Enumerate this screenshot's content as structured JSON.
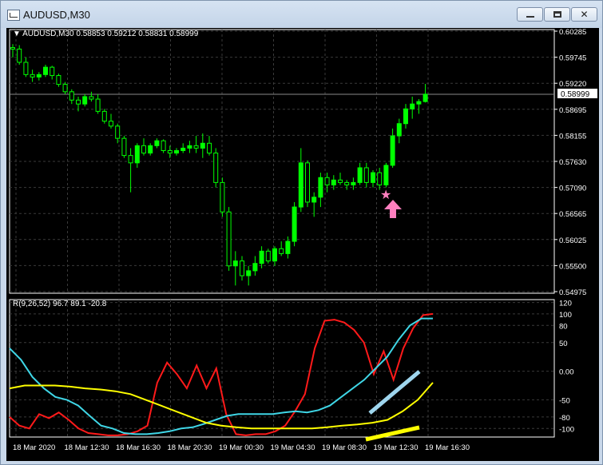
{
  "window": {
    "title": "AUDUSD,M30",
    "controls": {
      "minimize_icon": "minimize-icon",
      "maximize_icon": "maximize-icon",
      "close_label": "✕"
    }
  },
  "colors": {
    "background": "#000000",
    "grid": "#3a3a3a",
    "bull_candle": "#00ff00",
    "bear_candle": "#000000",
    "indicator_red": "#ff1a1a",
    "indicator_cyan": "#3fd6e6",
    "indicator_yellow": "#ffff00",
    "marker_pink": "#ff7fbf",
    "trend_line_lightblue": "#9fd6ee"
  },
  "main_panel": {
    "symbol_label": "AUDUSD,M30",
    "ohlc_text": "0.58853 0.59212 0.58831 0.58999",
    "current_price": "0.58999",
    "price_ticks": [
      "0.60285",
      "0.59745",
      "0.59220",
      "0.58695",
      "0.58155",
      "0.57630",
      "0.57090",
      "0.56565",
      "0.56025",
      "0.55500",
      "0.54975"
    ]
  },
  "indicator_panel": {
    "label": "R(9,26,52) 96.7 89.1 -20.8",
    "ticks": [
      "120",
      "100",
      "80",
      "50",
      "0.00",
      "-50",
      "-80",
      "-100"
    ]
  },
  "time_axis": {
    "labels": [
      "18 Mar 2020",
      "18 Mar 12:30",
      "18 Mar 16:30",
      "18 Mar 20:30",
      "19 Mar 00:30",
      "19 Mar 04:30",
      "19 Mar 08:30",
      "19 Mar 12:30",
      "19 Mar 16:30"
    ]
  },
  "chart_data": {
    "type": "candlestick",
    "price_range": [
      0.54975,
      0.60285
    ],
    "candles": [
      [
        0.5995,
        0.6002,
        0.5975,
        0.5992
      ],
      [
        0.5992,
        0.6,
        0.596,
        0.5965
      ],
      [
        0.5965,
        0.5975,
        0.5935,
        0.594
      ],
      [
        0.594,
        0.595,
        0.5925,
        0.5935
      ],
      [
        0.5935,
        0.5945,
        0.5928,
        0.594
      ],
      [
        0.594,
        0.596,
        0.5935,
        0.5955
      ],
      [
        0.5955,
        0.5958,
        0.593,
        0.5938
      ],
      [
        0.5938,
        0.5942,
        0.5915,
        0.592
      ],
      [
        0.592,
        0.5925,
        0.59,
        0.5905
      ],
      [
        0.5905,
        0.591,
        0.588,
        0.5888
      ],
      [
        0.5888,
        0.5895,
        0.5865,
        0.588
      ],
      [
        0.588,
        0.59,
        0.5875,
        0.5895
      ],
      [
        0.5895,
        0.5905,
        0.5885,
        0.589
      ],
      [
        0.589,
        0.59,
        0.586,
        0.5865
      ],
      [
        0.5865,
        0.587,
        0.584,
        0.5845
      ],
      [
        0.5845,
        0.586,
        0.583,
        0.5835
      ],
      [
        0.5835,
        0.584,
        0.58,
        0.581
      ],
      [
        0.581,
        0.5815,
        0.577,
        0.5775
      ],
      [
        0.5775,
        0.579,
        0.57,
        0.576
      ],
      [
        0.576,
        0.58,
        0.575,
        0.5795
      ],
      [
        0.5795,
        0.581,
        0.5775,
        0.578
      ],
      [
        0.578,
        0.58,
        0.5775,
        0.5795
      ],
      [
        0.5795,
        0.581,
        0.579,
        0.5805
      ],
      [
        0.5805,
        0.5808,
        0.578,
        0.5785
      ],
      [
        0.5785,
        0.5795,
        0.577,
        0.578
      ],
      [
        0.578,
        0.579,
        0.5775,
        0.5785
      ],
      [
        0.5785,
        0.58,
        0.578,
        0.579
      ],
      [
        0.579,
        0.5805,
        0.578,
        0.5795
      ],
      [
        0.5795,
        0.5815,
        0.578,
        0.579
      ],
      [
        0.579,
        0.582,
        0.577,
        0.58
      ],
      [
        0.58,
        0.5815,
        0.5775,
        0.578
      ],
      [
        0.578,
        0.579,
        0.571,
        0.572
      ],
      [
        0.572,
        0.573,
        0.565,
        0.566
      ],
      [
        0.566,
        0.567,
        0.554,
        0.555
      ],
      [
        0.555,
        0.558,
        0.551,
        0.556
      ],
      [
        0.556,
        0.557,
        0.552,
        0.553
      ],
      [
        0.553,
        0.555,
        0.551,
        0.554
      ],
      [
        0.554,
        0.557,
        0.553,
        0.5555
      ],
      [
        0.5555,
        0.559,
        0.5545,
        0.558
      ],
      [
        0.558,
        0.5585,
        0.5555,
        0.556
      ],
      [
        0.556,
        0.559,
        0.555,
        0.5585
      ],
      [
        0.5585,
        0.56,
        0.557,
        0.5575
      ],
      [
        0.5575,
        0.561,
        0.5565,
        0.56
      ],
      [
        0.56,
        0.568,
        0.559,
        0.567
      ],
      [
        0.567,
        0.579,
        0.566,
        0.576
      ],
      [
        0.576,
        0.5765,
        0.567,
        0.568
      ],
      [
        0.568,
        0.57,
        0.565,
        0.569
      ],
      [
        0.569,
        0.574,
        0.567,
        0.573
      ],
      [
        0.573,
        0.574,
        0.57,
        0.5715
      ],
      [
        0.5715,
        0.5735,
        0.5705,
        0.5725
      ],
      [
        0.5725,
        0.574,
        0.5715,
        0.572
      ],
      [
        0.572,
        0.5725,
        0.5705,
        0.5715
      ],
      [
        0.5715,
        0.573,
        0.5705,
        0.572
      ],
      [
        0.572,
        0.576,
        0.5715,
        0.575
      ],
      [
        0.575,
        0.576,
        0.571,
        0.572
      ],
      [
        0.572,
        0.5745,
        0.571,
        0.574
      ],
      [
        0.574,
        0.575,
        0.5705,
        0.5715
      ],
      [
        0.5715,
        0.576,
        0.571,
        0.5755
      ],
      [
        0.5755,
        0.583,
        0.575,
        0.5815
      ],
      [
        0.5815,
        0.585,
        0.58,
        0.584
      ],
      [
        0.584,
        0.588,
        0.583,
        0.587
      ],
      [
        0.587,
        0.5895,
        0.585,
        0.588
      ],
      [
        0.588,
        0.589,
        0.586,
        0.5885
      ],
      [
        0.5885,
        0.5921,
        0.5883,
        0.59
      ]
    ],
    "indicator_series": [
      {
        "name": "R9",
        "color": "#ff1a1a",
        "values": [
          -80,
          -95,
          -100,
          -75,
          -82,
          -72,
          -85,
          -100,
          -108,
          -110,
          -112,
          -112,
          -110,
          -105,
          -95,
          -20,
          15,
          -5,
          -30,
          10,
          -30,
          5,
          -75,
          -110,
          -112,
          -110,
          -110,
          -105,
          -95,
          -70,
          -40,
          40,
          88,
          90,
          85,
          72,
          50,
          -5,
          35,
          -15,
          40,
          75,
          98,
          100
        ]
      },
      {
        "name": "R26",
        "color": "#3fd6e6",
        "values": [
          40,
          20,
          -10,
          -30,
          -45,
          -50,
          -60,
          -78,
          -95,
          -100,
          -108,
          -110,
          -110,
          -108,
          -105,
          -100,
          -98,
          -92,
          -85,
          -78,
          -75,
          -75,
          -75,
          -75,
          -72,
          -70,
          -72,
          -68,
          -60,
          -45,
          -30,
          -15,
          5,
          25,
          55,
          80,
          92,
          92
        ]
      },
      {
        "name": "R52",
        "color": "#ffff00",
        "values": [
          -30,
          -25,
          -25,
          -25,
          -27,
          -30,
          -32,
          -35,
          -40,
          -50,
          -60,
          -70,
          -80,
          -90,
          -95,
          -98,
          -100,
          -100,
          -100,
          -100,
          -100,
          -98,
          -95,
          -93,
          -90,
          -85,
          -70,
          -50,
          -20
        ]
      }
    ],
    "indicator_range": [
      -115,
      125
    ]
  }
}
